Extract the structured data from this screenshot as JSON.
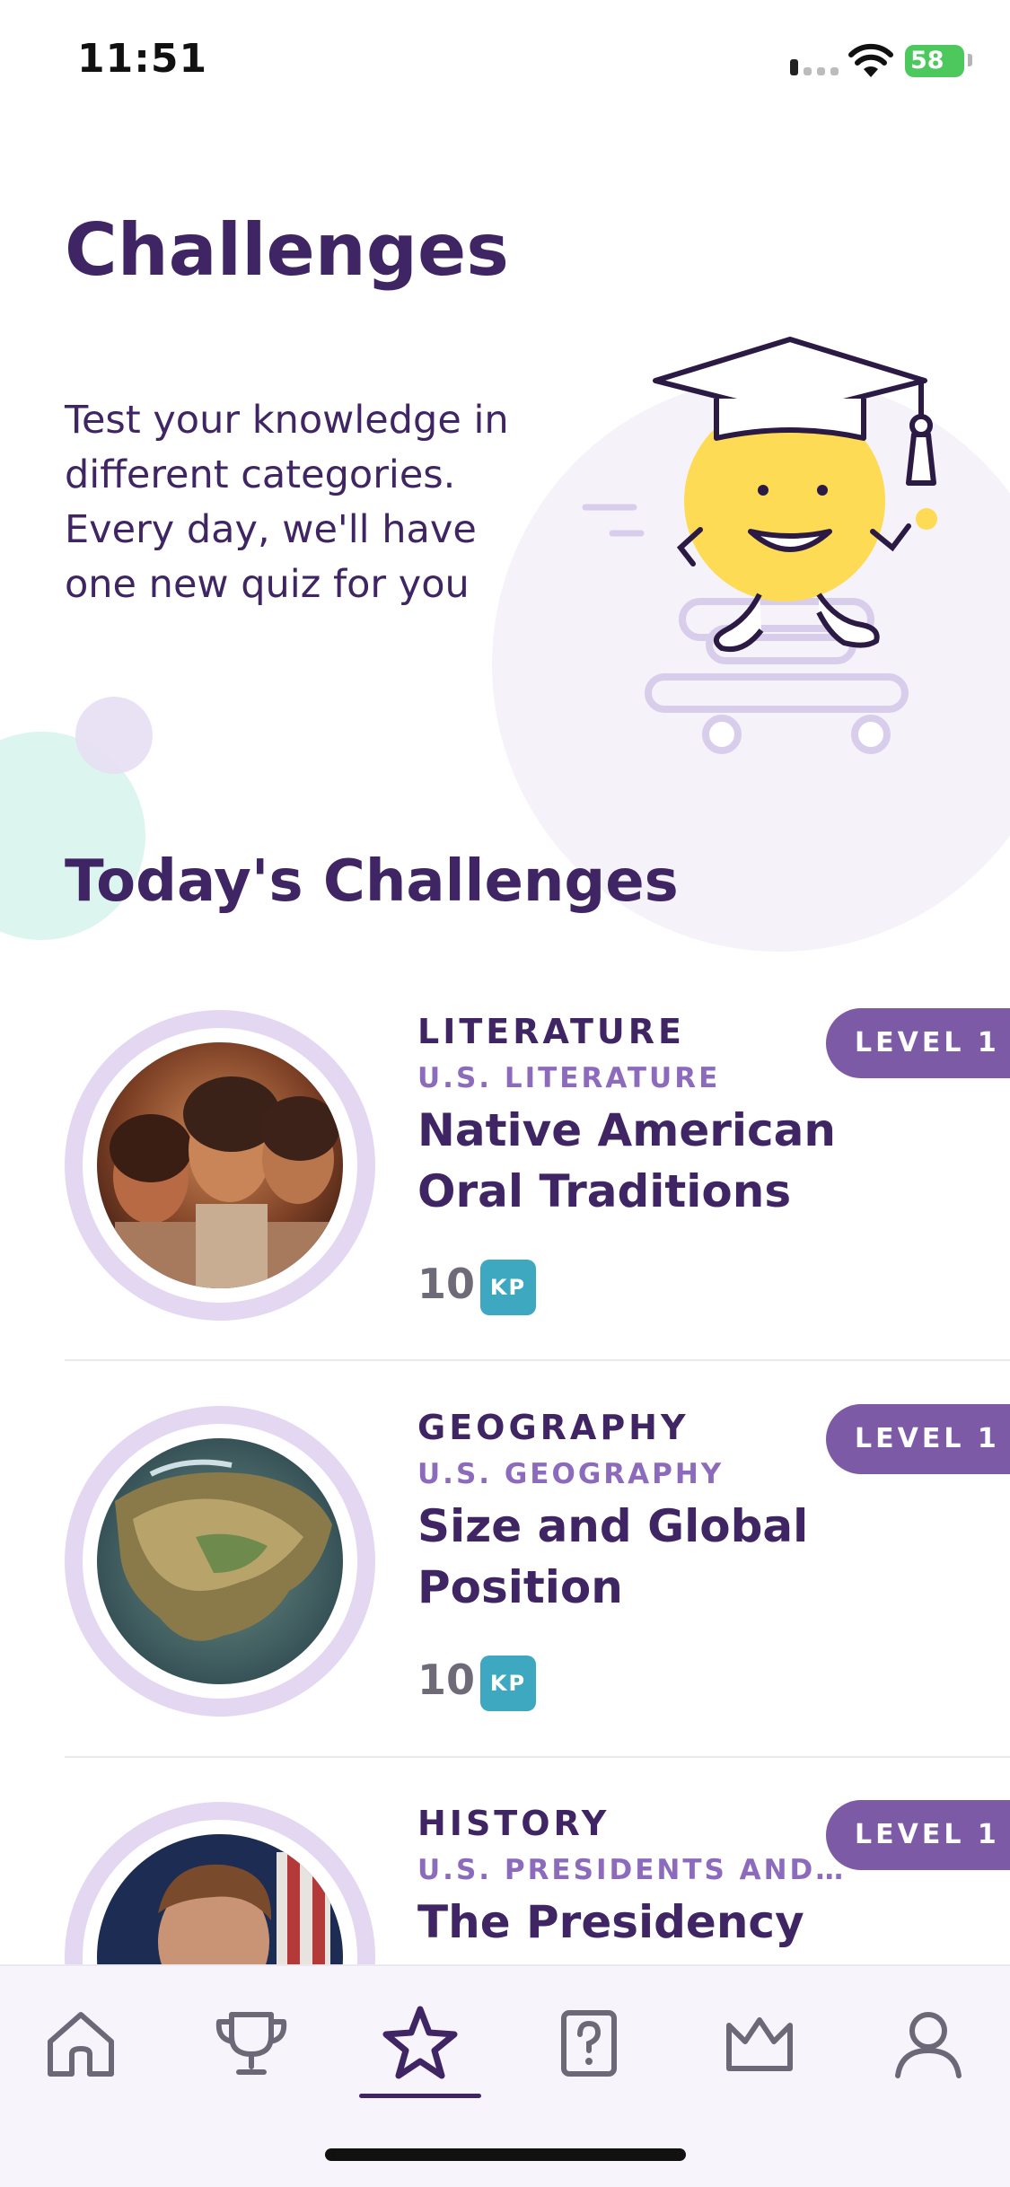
{
  "status_bar": {
    "time": "11:51",
    "battery": "58"
  },
  "header": {
    "title": "Challenges",
    "intro": "Test your knowledge in different categories. Every day, we'll have one new quiz for you"
  },
  "section_title": "Today's Challenges",
  "challenges": [
    {
      "category": "LITERATURE",
      "subcategory": "U.S. LITERATURE",
      "title": "Native American Oral Traditions",
      "points": "10",
      "points_unit": "KP",
      "level": "LEVEL 1"
    },
    {
      "category": "GEOGRAPHY",
      "subcategory": "U.S. GEOGRAPHY",
      "title": "Size and Global Position",
      "points": "10",
      "points_unit": "KP",
      "level": "LEVEL 1"
    },
    {
      "category": "HISTORY",
      "subcategory": "U.S. PRESIDENTS AND…",
      "title": "The Presidency",
      "level": "LEVEL 1"
    }
  ],
  "tab_bar": {
    "tabs": [
      "home-icon",
      "trophy-icon",
      "star-icon",
      "quiz-icon",
      "crown-icon",
      "profile-icon"
    ],
    "active": "star-icon"
  },
  "colors": {
    "primary": "#3f2563",
    "accent": "#7d5aa6",
    "kp_badge": "#3ea8c0",
    "ring": "#e4d7f2"
  }
}
